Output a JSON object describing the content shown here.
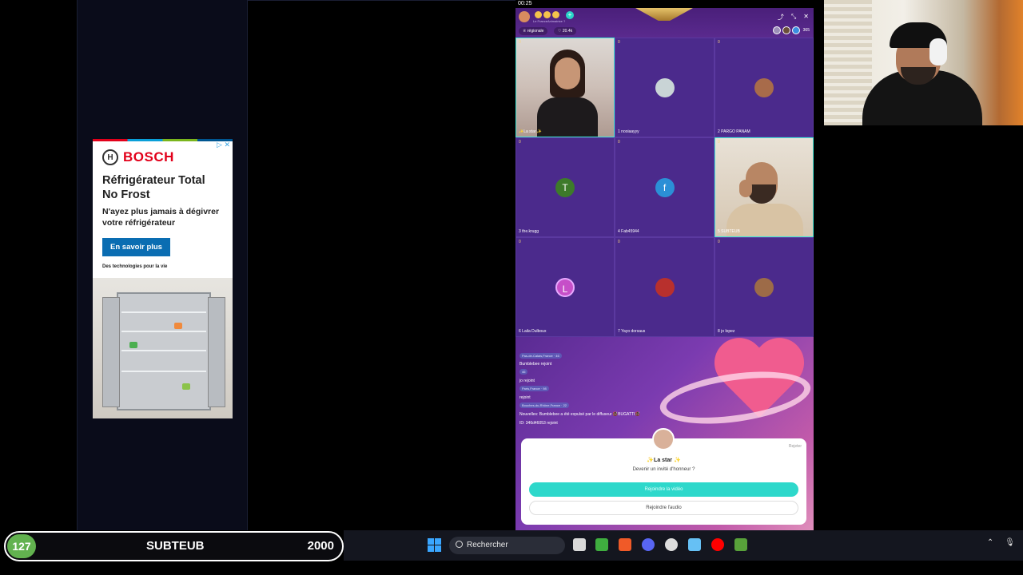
{
  "status": {
    "clock": "00:25"
  },
  "ad": {
    "close_label": "▷ ✕",
    "brand": "BOSCH",
    "title": "Réfrigérateur Total No Frost",
    "subtitle": "N'ayez plus jamais à dégivrer votre réfrigérateur",
    "cta": "En savoir plus",
    "tagline": "Des technologies pour la vie"
  },
  "live": {
    "host_name": "Le FranceAnimatrice ?",
    "region_pill": "♕ régionale",
    "likes_pill": "♡ 20.4k",
    "viewer_count": "365",
    "header_icons": [
      "share-icon",
      "minimize-icon",
      "close-icon"
    ],
    "cells": [
      {
        "badge": "0",
        "label": "✨La star ✨",
        "avatar": "",
        "type": "cam-woman"
      },
      {
        "badge": "0",
        "label": "1 nooiaayyy",
        "avatar": "",
        "type": "avatar",
        "color": "#c9d4d6"
      },
      {
        "badge": "0",
        "label": "2 PARGO PANAM",
        "avatar": "",
        "type": "avatar",
        "color": "#a86b4a"
      },
      {
        "badge": "0",
        "label": "3 the.krugg",
        "avatar": "T",
        "type": "avatar",
        "color": "#3d7a2a"
      },
      {
        "badge": "0",
        "label": "4 Fab45944",
        "avatar": "f",
        "type": "avatar",
        "color": "#2b8fd6"
      },
      {
        "badge": "0",
        "label": "5 SUBTEUB",
        "avatar": "",
        "type": "cam-man"
      },
      {
        "badge": "0",
        "label": "6 Laila Dulboux",
        "avatar": "L",
        "type": "avatar",
        "color": "#c64fc8"
      },
      {
        "badge": "0",
        "label": "7 Yayo dorsaus",
        "avatar": "",
        "type": "avatar",
        "color": "#b8302d"
      },
      {
        "badge": "0",
        "label": "8 jo lopez",
        "avatar": "",
        "type": "avatar",
        "color": "#9d6b48"
      }
    ],
    "chat": [
      {
        "pill": "Pas-de-Calais,France · 46"
      },
      {
        "text": "Bumblebee rejoint"
      },
      {
        "pill": "46"
      },
      {
        "text": "jo rejoint"
      },
      {
        "pill": "Paris,France · 98"
      },
      {
        "text": "rejoint"
      },
      {
        "pill": "Bouches-du-Rhône,France · 22"
      },
      {
        "text": "Nouvelles: Bumblebee a été expulsé par le diffuseur 🚭BUGATTI🚭"
      },
      {
        "text": "ID: 346d46053 rejoint"
      }
    ],
    "invite": {
      "reject": "Rejeter",
      "title": "✨La star ✨",
      "subtitle": "Devenir un invité d'honneur ?",
      "video_button": "Rejoindre la vidéo",
      "audio_button": "Rejoindre l'audio"
    }
  },
  "subgoal": {
    "count": "127",
    "label": "SUBTEUB",
    "goal": "2000"
  },
  "taskbar": {
    "search_placeholder": "Rechercher",
    "apps": [
      {
        "name": "file-explorer-icon",
        "color": "#d9d9d9"
      },
      {
        "name": "spreadsheet-icon",
        "color": "#3fae3f"
      },
      {
        "name": "brave-browser-icon",
        "color": "#f05a28"
      },
      {
        "name": "discord-icon",
        "color": "#5865f2"
      },
      {
        "name": "obs-icon",
        "color": "#dddddd"
      },
      {
        "name": "steam-icon",
        "color": "#66c0f4"
      },
      {
        "name": "youtube-icon",
        "color": "#ff0000"
      },
      {
        "name": "app-icon",
        "color": "#58a13a"
      }
    ],
    "tray": [
      "chevron-up-icon",
      "microphone-icon"
    ]
  }
}
